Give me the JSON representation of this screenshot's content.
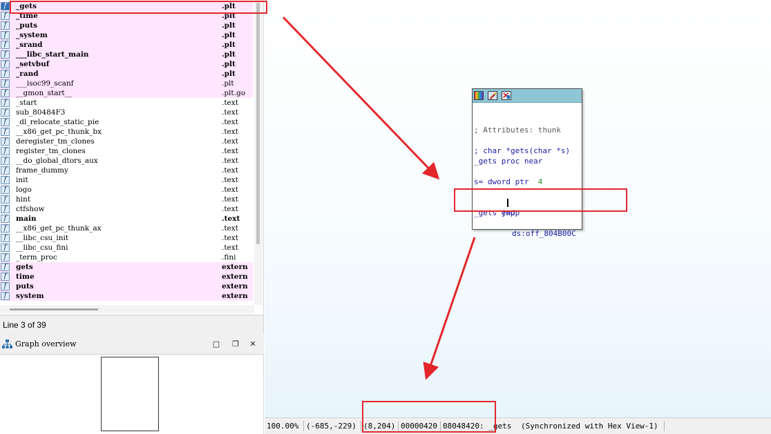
{
  "functions": [
    {
      "name": "_gets",
      "segment": ".plt",
      "bold": true,
      "pink": true,
      "selected": true
    },
    {
      "name": "_time",
      "segment": ".plt",
      "bold": true,
      "pink": true
    },
    {
      "name": "_puts",
      "segment": ".plt",
      "bold": true,
      "pink": true
    },
    {
      "name": "_system",
      "segment": ".plt",
      "bold": true,
      "pink": true
    },
    {
      "name": "_srand",
      "segment": ".plt",
      "bold": true,
      "pink": true
    },
    {
      "name": "___libc_start_main",
      "segment": ".plt",
      "bold": true,
      "pink": true
    },
    {
      "name": "_setvbuf",
      "segment": ".plt",
      "bold": true,
      "pink": true
    },
    {
      "name": "_rand",
      "segment": ".plt",
      "bold": true,
      "pink": true
    },
    {
      "name": "___isoc99_scanf",
      "segment": ".plt",
      "bold": false,
      "pink": true
    },
    {
      "name": "__gmon_start__",
      "segment": ".plt.go",
      "bold": false,
      "pink": true
    },
    {
      "name": "_start",
      "segment": ".text",
      "bold": false,
      "pink": false
    },
    {
      "name": "sub_80484F3",
      "segment": ".text",
      "bold": false,
      "pink": false
    },
    {
      "name": "_dl_relocate_static_pie",
      "segment": ".text",
      "bold": false,
      "pink": false
    },
    {
      "name": "__x86_get_pc_thunk_bx",
      "segment": ".text",
      "bold": false,
      "pink": false
    },
    {
      "name": "deregister_tm_clones",
      "segment": ".text",
      "bold": false,
      "pink": false
    },
    {
      "name": "register_tm_clones",
      "segment": ".text",
      "bold": false,
      "pink": false
    },
    {
      "name": "__do_global_dtors_aux",
      "segment": ".text",
      "bold": false,
      "pink": false
    },
    {
      "name": "frame_dummy",
      "segment": ".text",
      "bold": false,
      "pink": false
    },
    {
      "name": "init",
      "segment": ".text",
      "bold": false,
      "pink": false
    },
    {
      "name": "logo",
      "segment": ".text",
      "bold": false,
      "pink": false
    },
    {
      "name": "hint",
      "segment": ".text",
      "bold": false,
      "pink": false
    },
    {
      "name": "ctfshow",
      "segment": ".text",
      "bold": false,
      "pink": false
    },
    {
      "name": "main",
      "segment": ".text",
      "bold": true,
      "pink": false
    },
    {
      "name": "__x86_get_pc_thunk_ax",
      "segment": ".text",
      "bold": false,
      "pink": false
    },
    {
      "name": "__libc_csu_init",
      "segment": ".text",
      "bold": false,
      "pink": false
    },
    {
      "name": "__libc_csu_fini",
      "segment": ".text",
      "bold": false,
      "pink": false
    },
    {
      "name": "_term_proc",
      "segment": ".fini",
      "bold": false,
      "pink": false
    },
    {
      "name": "gets",
      "segment": "extern",
      "bold": true,
      "pink": true
    },
    {
      "name": "time",
      "segment": "extern",
      "bold": true,
      "pink": true
    },
    {
      "name": "puts",
      "segment": "extern",
      "bold": true,
      "pink": true
    },
    {
      "name": "system",
      "segment": "extern",
      "bold": true,
      "pink": true
    }
  ],
  "function_icon_glyph": "f",
  "line_status": "Line 3 of 39",
  "overview": {
    "title": "Graph overview",
    "maximize_glyph": "□",
    "restore_glyph": "❐",
    "close_glyph": "✕"
  },
  "node": {
    "comment_attr": "; Attributes: thunk",
    "comment_proto": "; char *gets(char *s)",
    "proc_line": "_gets proc near",
    "var_prefix": "s= dword ptr  ",
    "var_value": "4",
    "instr_mnemonic": "jmp",
    "instr_operand": "ds:off_804B00C",
    "endp_line": "_gets endp"
  },
  "statusbar": {
    "zoom": "100.00%",
    "graph_coords": "(-685,-229)",
    "mouse_coords": "(8,204)",
    "file_offset": "00000420",
    "address_symbol": "08048420: _gets",
    "sync_text": "(Synchronized with Hex View-1)"
  },
  "colors": {
    "annotation_red": "#e3262b",
    "pink_row": "#ffe6ff",
    "node_header": "#8fc6d6",
    "asm_blue": "#1a1aa6",
    "number_green": "#2e8b2e"
  }
}
